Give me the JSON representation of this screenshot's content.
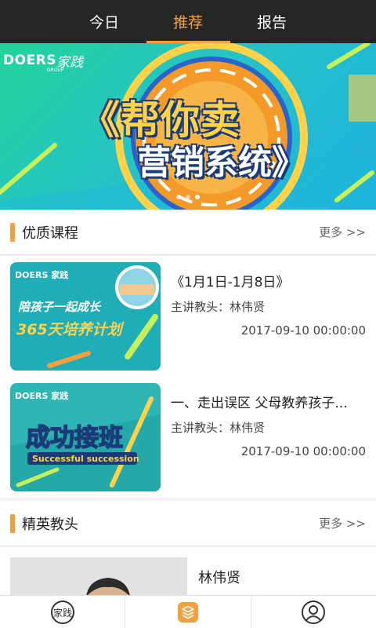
{
  "tabs": [
    {
      "label": "今日",
      "active": false
    },
    {
      "label": "推荐",
      "active": true
    },
    {
      "label": "报告",
      "active": false
    }
  ],
  "accent_color": "#f5a03c",
  "banner": {
    "brand": "DOERS",
    "brand_sub": "GROUP",
    "brand_cn": "家践",
    "line1": "《帮你卖",
    "line2": "营销系统》",
    "active_dot": 3,
    "dot_count": 3
  },
  "courses_section": {
    "title": "优质课程",
    "more": "更多 >>"
  },
  "courses": [
    {
      "title": "《1月1日-1月8日》",
      "teacher": "主讲教头：林伟贤",
      "date": "2017-09-10 00:00:00",
      "thumb_brand": "DOERS 家践",
      "thumb_line1": "陪孩子一起成长",
      "thumb_line2": "365天培养计划"
    },
    {
      "title": "一、走出误区 父母教养孩子...",
      "teacher": "主讲教头：林伟贤",
      "date": "2017-09-10 00:00:00",
      "thumb_brand": "DOERS 家践",
      "thumb_line1": "成功接班",
      "thumb_line2": "Successful succession"
    }
  ],
  "teachers_section": {
    "title": "精英教头",
    "more": "更多 >>"
  },
  "teachers": [
    {
      "name": "林伟贤"
    }
  ],
  "bottom_nav": [
    {
      "icon": "brand-logo-icon",
      "logo_text": "家践"
    },
    {
      "icon": "layers-icon"
    },
    {
      "icon": "user-icon"
    }
  ]
}
